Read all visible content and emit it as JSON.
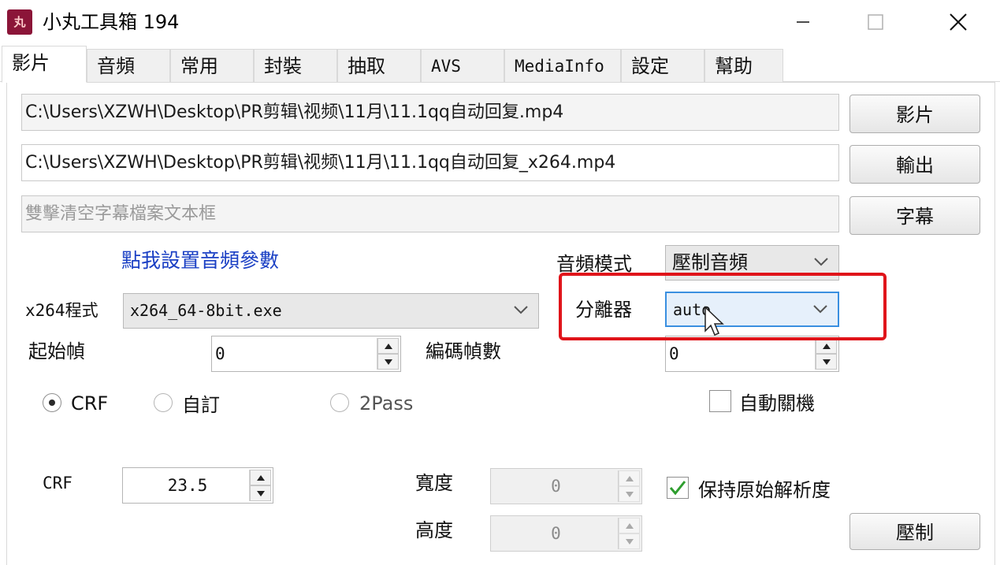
{
  "window": {
    "title": "小丸工具箱 194",
    "app_icon_glyph": "丸",
    "accent_colors": {
      "app_icon": "#8b1538",
      "highlight_box": "#e0141a",
      "link": "#1a3fc4",
      "focus": "#3a8fe0"
    }
  },
  "tabs": [
    {
      "label": "影片",
      "active": true
    },
    {
      "label": "音頻"
    },
    {
      "label": "常用"
    },
    {
      "label": "封裝"
    },
    {
      "label": "抽取"
    },
    {
      "label": "AVS"
    },
    {
      "label": "MediaInfo"
    },
    {
      "label": "設定"
    },
    {
      "label": "幫助"
    }
  ],
  "files": {
    "input_path": "C:\\Users\\XZWH\\Desktop\\PR剪辑\\视频\\11月\\11.1qq自动回复.mp4",
    "output_path": "C:\\Users\\XZWH\\Desktop\\PR剪辑\\视频\\11月\\11.1qq自动回复_x264.mp4",
    "subtitle_placeholder": "雙擊清空字幕檔案文本框",
    "video_button": "影片",
    "output_button": "輸出",
    "subtitle_button": "字幕"
  },
  "audio": {
    "settings_link": "點我設置音頻參數",
    "mode_label": "音頻模式",
    "mode_value": "壓制音頻"
  },
  "x264": {
    "program_label": "x264程式",
    "program_value": "x264_64-8bit.exe",
    "demuxer_label": "分離器",
    "demuxer_value": "auto",
    "start_frame_label": "起始幀",
    "start_frame_value": "0",
    "encode_frames_label": "編碼幀數",
    "encode_frames_value": "0"
  },
  "rate_mode": {
    "options": [
      "CRF",
      "自訂",
      "2Pass"
    ],
    "selected": "CRF",
    "auto_shutdown_label": "自動關機",
    "auto_shutdown_checked": false
  },
  "crf": {
    "label": "CRF",
    "value": "23.5"
  },
  "resolution": {
    "width_label": "寬度",
    "width_value": "0",
    "height_label": "高度",
    "height_value": "0",
    "keep_original_label": "保持原始解析度",
    "keep_original_checked": true
  },
  "encode_button": "壓制"
}
